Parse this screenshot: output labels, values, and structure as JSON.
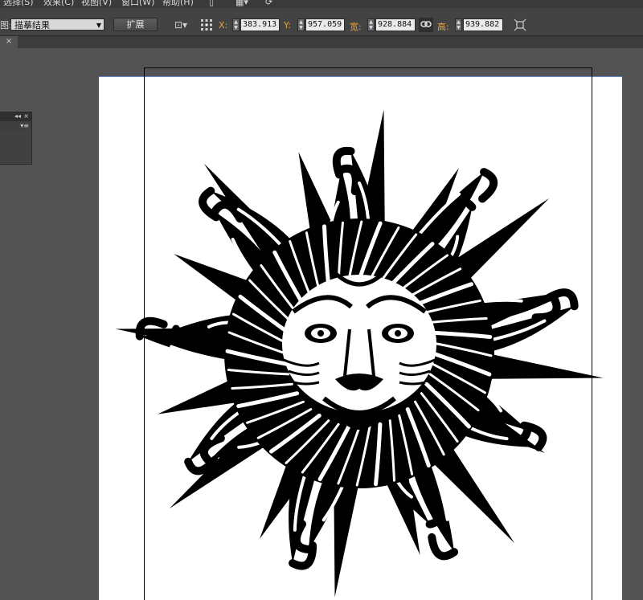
{
  "menu": [
    "选择(S)",
    "效果(C)",
    "视图(V)",
    "窗口(W)",
    "帮助(H)"
  ],
  "control": {
    "view_label": "图:",
    "view_value": "描摹结果",
    "expand_button": "扩展",
    "x_label": "X:",
    "x_value": "383.913",
    "y_label": "Y:",
    "y_value": "957.059",
    "w_label": "宽:",
    "w_value": "928.884",
    "h_label": "高:",
    "h_value": "939.882"
  },
  "tab": {
    "close": "×"
  },
  "panel": {
    "collapse": "◂◂",
    "close": "×",
    "menu": "▾≡"
  },
  "icons": [
    "reference-point-icon",
    "link-proportions-icon",
    "transform-icon",
    "arrange-icon"
  ],
  "colors": {
    "accent_axis": "#e8a23b",
    "artboard_edge": "#6c8fd8",
    "background": "#535353"
  }
}
